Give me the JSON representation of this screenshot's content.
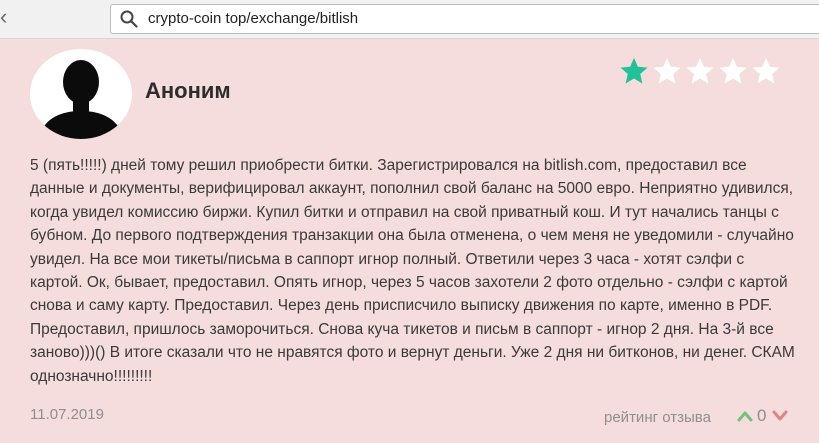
{
  "browser": {
    "url": "crypto-coin top/exchange/bitlish",
    "icons": {
      "back": "chevron-left-icon",
      "search": "search-icon"
    }
  },
  "review": {
    "author": "Аноним",
    "avatar_icon": "anonymous-silhouette-avatar",
    "stars": {
      "filled": 1,
      "total": 5
    },
    "text": "5 (пять!!!!!) дней тому решил приобрести битки. Зарегистрировался на bitlish.com, предоставил все данные и документы, верифицировал аккаунт, пополнил свой баланс на 5000 евро. Неприятно удивился, когда увидел комиссию биржи. Купил битки и отправил на свой приватный кош. И тут начались танцы с бубном. До первого подтверждения транзакции она была отменена, о чем меня не уведомили - случайно увидел. На все мои тикеты/письма в саппорт игнор полный. Ответили через 3 часа - хотят сэлфи с картой. Ок, бывает, предоставил. Опять игнор, через 5 часов захотели 2 фото отдельно - сэлфи с картой снова и саму карту. Предоставил. Через день присписчило выписку движения по карте, именно в PDF. Предоставил, пришлось заморочиться. Снова куча тикетов и письм в саппорт - игнор 2 дня. На 3-й все заново)))() В итоге сказали что не нравятся фото и вернут деньги. Уже 2 дня ни битконов, ни денег. СКАМ однозначно!!!!!!!!!",
    "date": "11.07.2019",
    "rating_label": "рейтинг отзыва",
    "votes": "0"
  },
  "colors": {
    "background": "#f5dcdd",
    "star_filled": "#23c197",
    "star_empty": "#ffffff",
    "vote_up": "#74c27a",
    "vote_down": "#e0847f"
  }
}
